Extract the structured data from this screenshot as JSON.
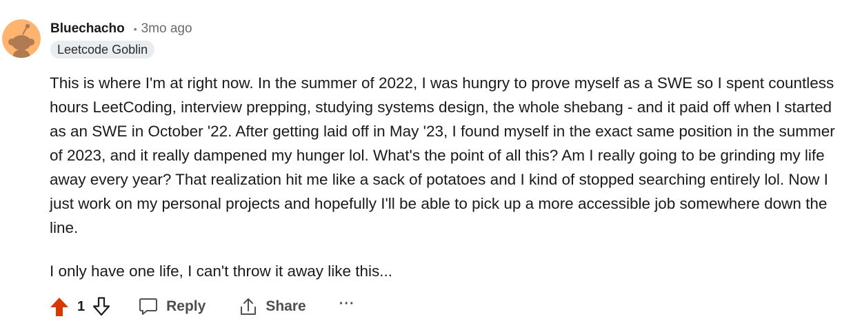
{
  "comment": {
    "author": "Bluechacho",
    "separator": "•",
    "timestamp": "3mo ago",
    "flair": "Leetcode Goblin",
    "paragraphs": [
      "This is where I'm at right now. In the summer of 2022, I was hungry to prove myself as a SWE so I spent countless hours LeetCoding, interview prepping, studying systems design, the whole shebang - and it paid off when I started as an SWE in October '22. After getting laid off in May '23, I found myself in the exact same position in the summer of 2023, and it really dampened my hunger lol. What's the point of all this? Am I really going to be grinding my life away every year? That realization hit me like a sack of potatoes and I kind of stopped searching entirely lol. Now I just work on my personal projects and hopefully I'll be able to pick up a more accessible job somewhere down the line.",
      "I only have one life, I can't throw it away like this..."
    ]
  },
  "actions": {
    "score": "1",
    "reply_label": "Reply",
    "share_label": "Share",
    "more_label": "···",
    "upvote_icon": "upvote-filled-icon",
    "downvote_icon": "downvote-outline-icon",
    "reply_icon": "comment-bubble-icon",
    "share_icon": "share-arrow-icon"
  },
  "colors": {
    "upvote_active": "#d93900",
    "avatar_bg": "#ffb470",
    "flair_bg": "#eaedef",
    "muted_text": "#6a6a6a"
  }
}
